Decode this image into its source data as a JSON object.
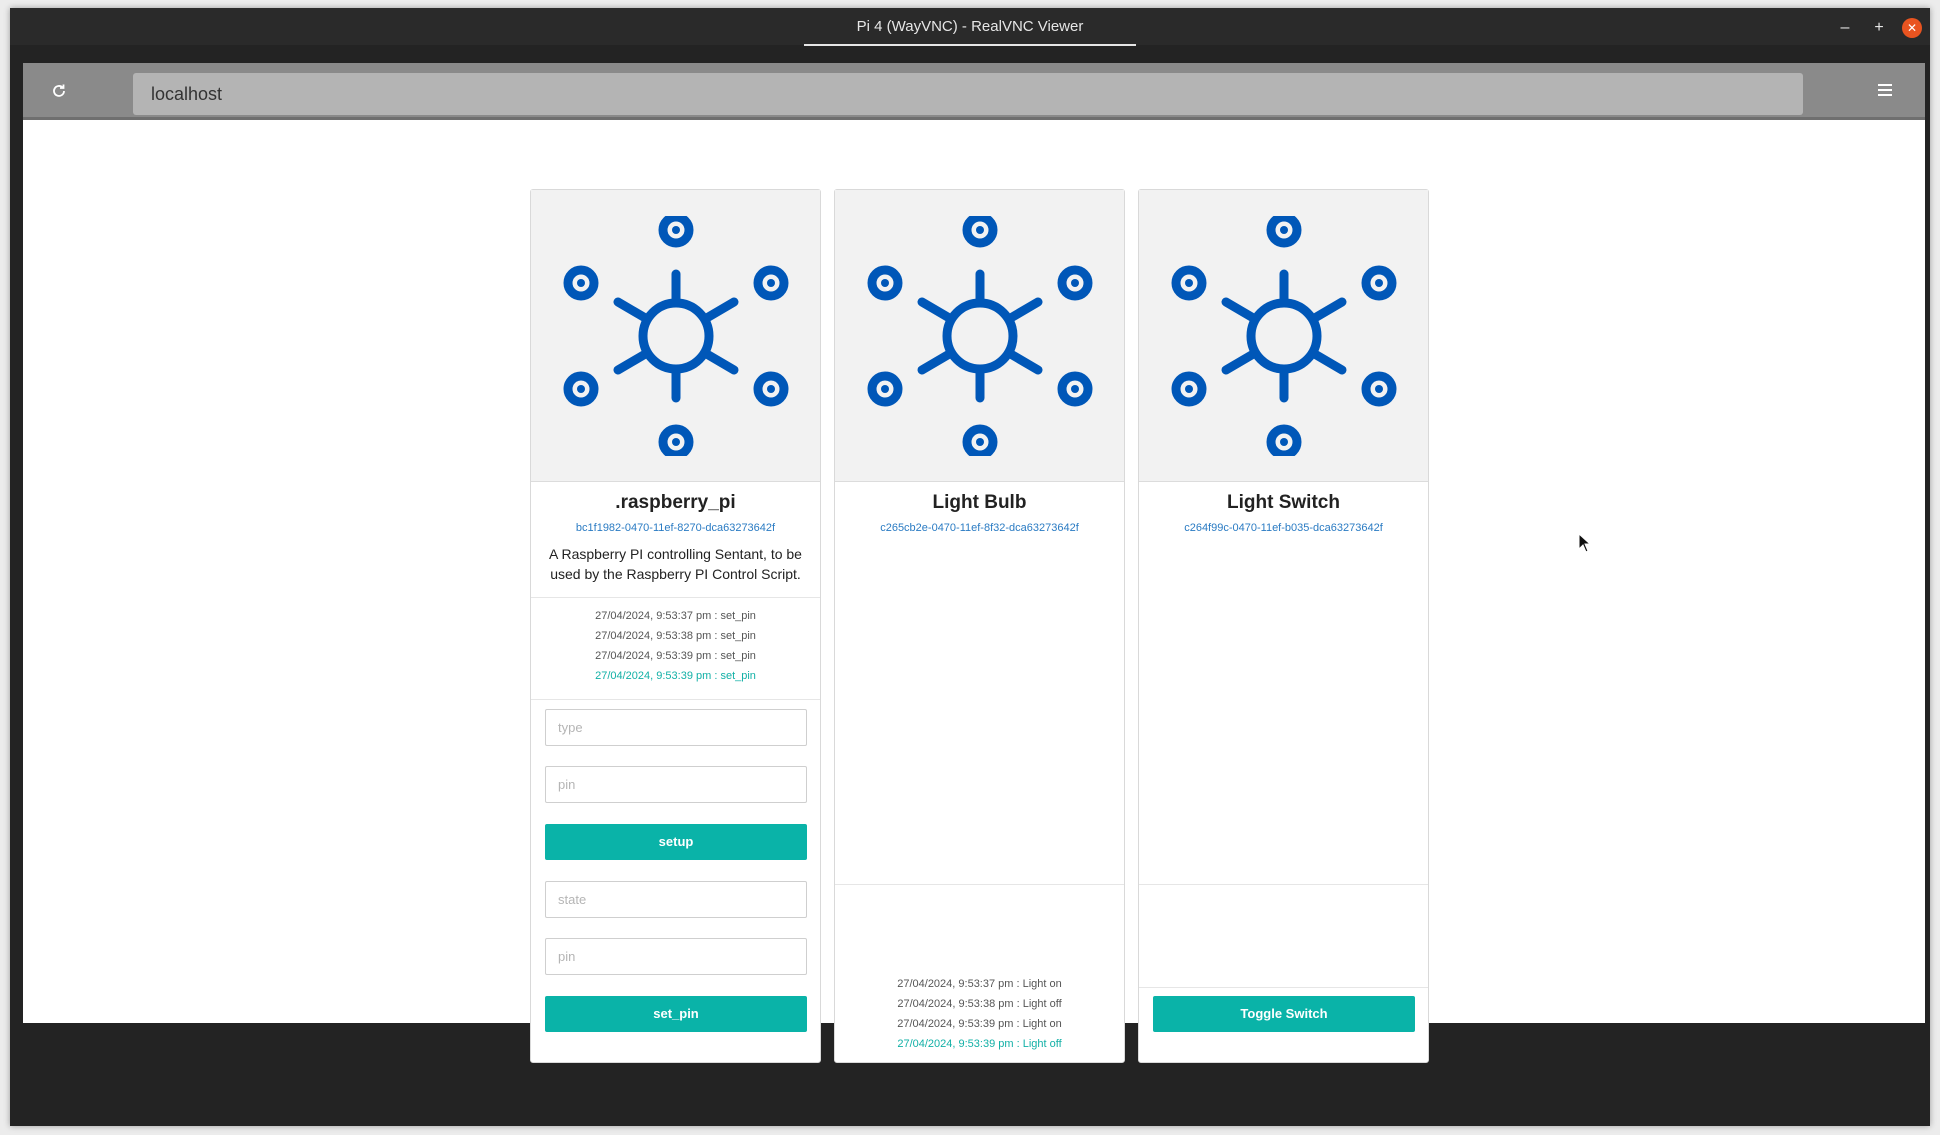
{
  "window": {
    "title": "Pi 4 (WayVNC) - RealVNC Viewer",
    "minimize": "–",
    "maximize": "+",
    "close": "✕"
  },
  "browser": {
    "url": "localhost",
    "reload_icon": "reload-icon",
    "menu_icon": "hamburger-menu-icon"
  },
  "colors": {
    "accent": "#0ab3a8",
    "link": "#2a7bc3",
    "icon": "#0057b8",
    "log_latest": "#12b0a6"
  },
  "cards": [
    {
      "title": ".raspberry_pi",
      "id": "bc1f1982-0470-11ef-8270-dca63273642f",
      "description": "A Raspberry PI controlling Sentant, to be used by the Raspberry PI Control Script.",
      "log": [
        "27/04/2024, 9:53:37 pm : set_pin",
        "27/04/2024, 9:53:38 pm : set_pin",
        "27/04/2024, 9:53:39 pm : set_pin",
        "27/04/2024, 9:53:39 pm : set_pin"
      ],
      "form1": {
        "type_placeholder": "type",
        "pin_placeholder": "pin",
        "button": "setup"
      },
      "form2": {
        "state_placeholder": "state",
        "pin_placeholder": "pin",
        "button": "set_pin"
      }
    },
    {
      "title": "Light Bulb",
      "id": "c265cb2e-0470-11ef-8f32-dca63273642f",
      "log": [
        "27/04/2024, 9:53:37 pm : Light on",
        "27/04/2024, 9:53:38 pm : Light off",
        "27/04/2024, 9:53:39 pm : Light on",
        "27/04/2024, 9:53:39 pm : Light off"
      ]
    },
    {
      "title": "Light Switch",
      "id": "c264f99c-0470-11ef-b035-dca63273642f",
      "button": "Toggle Switch"
    }
  ]
}
